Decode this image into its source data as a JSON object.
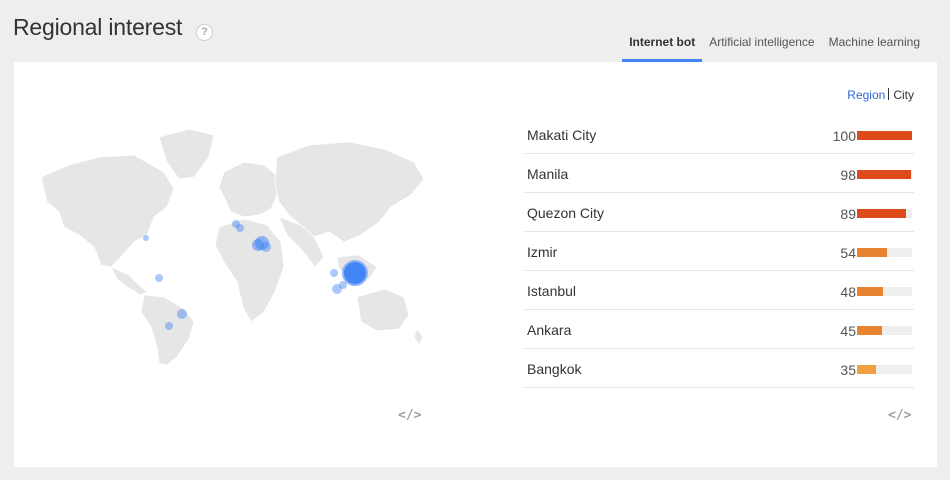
{
  "header": {
    "title": "Regional interest",
    "help_icon": "?"
  },
  "tabs": [
    {
      "label": "Internet bot",
      "active": true
    },
    {
      "label": "Artificial intelligence",
      "active": false
    },
    {
      "label": "Machine learning",
      "active": false
    }
  ],
  "toggle": {
    "region": "Region",
    "city": "City",
    "selected": "City"
  },
  "embed_icon": "</>",
  "map_markers": [
    {
      "place": "Makati City",
      "size": "large"
    },
    {
      "place": "Istanbul",
      "size": "medium"
    },
    {
      "place": "Izmir",
      "size": "medium"
    }
  ],
  "ranking": [
    {
      "name": "Makati City",
      "value": 100,
      "color": "#dd4b1a"
    },
    {
      "name": "Manila",
      "value": 98,
      "color": "#dd4b1a"
    },
    {
      "name": "Quezon City",
      "value": 89,
      "color": "#dd4b1a"
    },
    {
      "name": "Izmir",
      "value": 54,
      "color": "#e8832f"
    },
    {
      "name": "Istanbul",
      "value": 48,
      "color": "#e8832f"
    },
    {
      "name": "Ankara",
      "value": 45,
      "color": "#e8832f"
    },
    {
      "name": "Bangkok",
      "value": 35,
      "color": "#f0a040"
    }
  ],
  "colors": {
    "accent": "#4285f4",
    "marker": "#4285f4",
    "marker_light": "#a6c2f6"
  }
}
